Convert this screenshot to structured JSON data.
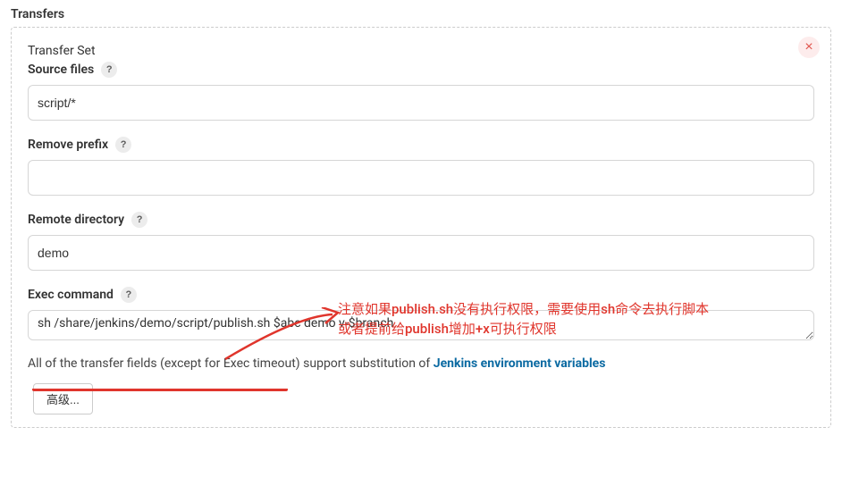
{
  "section": {
    "header": "Transfers"
  },
  "transferSet": {
    "title": "Transfer Set",
    "close_label": "×",
    "sourceFiles": {
      "label": "Source files",
      "value": "script/*"
    },
    "removePrefix": {
      "label": "Remove prefix",
      "value": ""
    },
    "remoteDirectory": {
      "label": "Remote directory",
      "value": "demo"
    },
    "execCommand": {
      "label": "Exec command",
      "value": "sh /share/jenkins/demo/script/publish.sh $abc demo v-$branch"
    },
    "hint_prefix": "All of the transfer fields (except for Exec timeout) support substitution of ",
    "hint_link": "Jenkins environment variables",
    "advanced_label": "高级..."
  },
  "annotation": {
    "line1": "注意如果publish.sh没有执行权限，需要使用sh命令去执行脚本",
    "line2": "或者提前给publish增加+x可执行权限"
  },
  "help_glyph": "?"
}
